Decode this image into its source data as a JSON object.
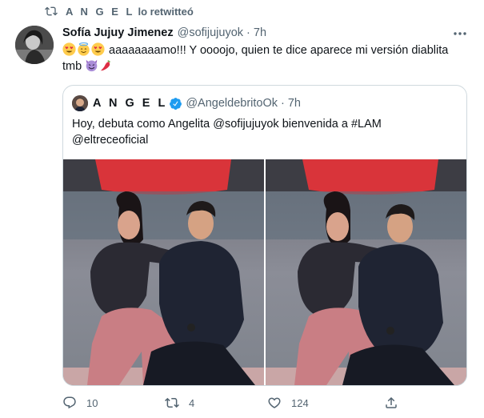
{
  "retweet": {
    "name": "A N G E L",
    "suffix": "lo retwitteó"
  },
  "tweet": {
    "author_name": "Sofía Jujuy Jimenez",
    "handle": "@sofijujuyok",
    "separator": "·",
    "time": "7h",
    "text_main": " aaaaaaaamo!!! Y oooojo, quien te dice aparece mi versión diablita",
    "text_end": "tmb ",
    "emojis_start": [
      "heart-eyes",
      "halo",
      "heart-eyes"
    ],
    "emojis_end": [
      "smiling-devil",
      "hot-pepper"
    ]
  },
  "quoted": {
    "author_name": "A N G E L",
    "handle": "@AngeldebritoOk",
    "separator": "·",
    "time": "7h",
    "text_line1": "Hoy, debuta como Angelita @sofijujuyok bienvenida a #LAM",
    "text_line2": "@eltreceoficial"
  },
  "actions": {
    "reply_count": "10",
    "retweet_count": "4",
    "like_count": "124"
  },
  "colors": {
    "text": "#0f1419",
    "secondary": "#536471",
    "accent": "#1d9bf0",
    "border": "#cfd9de"
  },
  "icons": [
    "retweet-icon",
    "more-icon",
    "verified-icon",
    "reply-icon",
    "like-icon",
    "share-icon"
  ]
}
